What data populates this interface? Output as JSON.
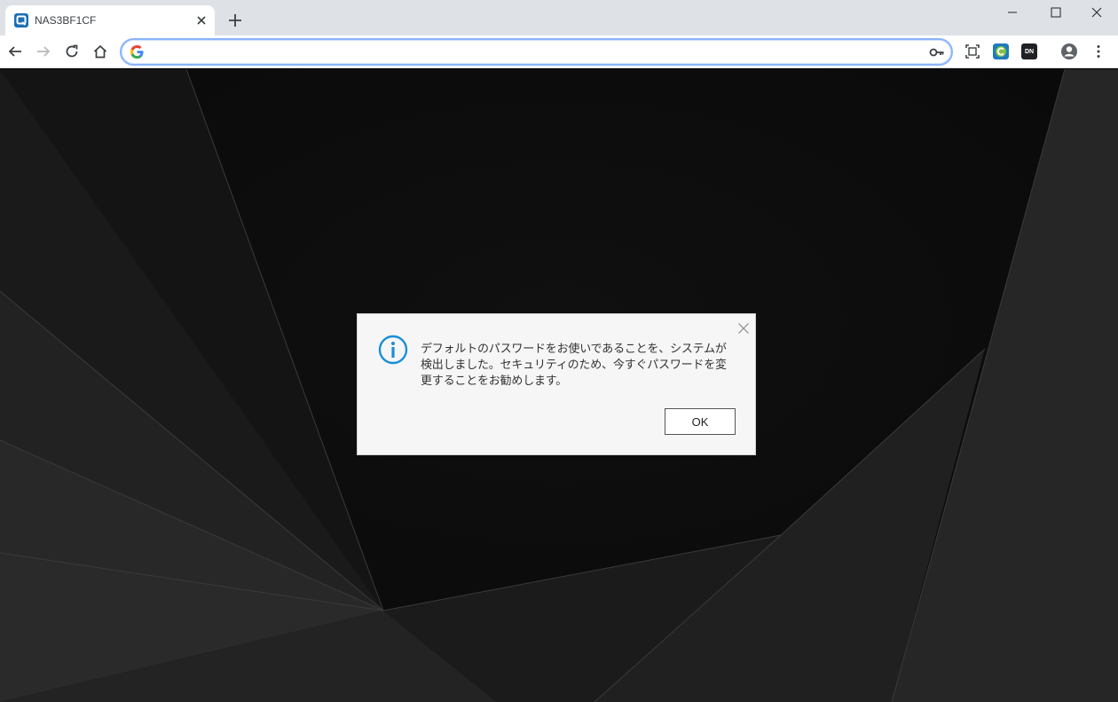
{
  "browser": {
    "tab": {
      "title": "NAS3BF1CF"
    },
    "omnibox": {
      "value": "",
      "placeholder": ""
    }
  },
  "dialog": {
    "message": "デフォルトのパスワードをお使いであることを、システムが検出しました。セキュリティのため、今すぐパスワードを変更することをお勧めします。",
    "ok_label": "OK"
  },
  "extensions": {
    "dn_label": "DN"
  },
  "colors": {
    "info_blue": "#1a8fd8",
    "tab_favicon": "#1c6fb6",
    "dialog_bg": "#f6f6f6"
  }
}
